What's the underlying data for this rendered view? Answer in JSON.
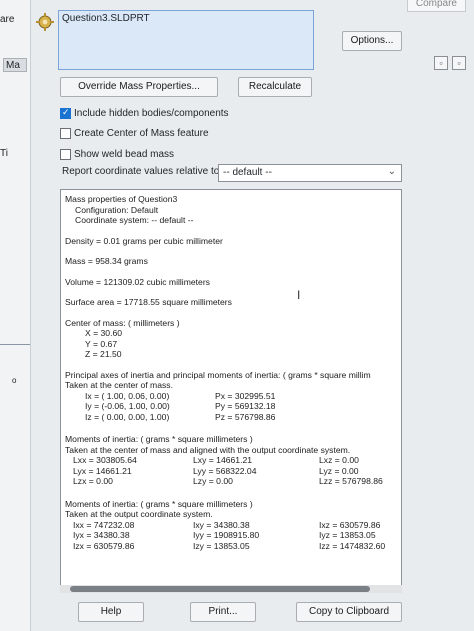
{
  "left_strip": {
    "top_text": "are",
    "box_text": "Ma",
    "mid_text": "Ti",
    "small_text": "o"
  },
  "header": {
    "compare": "Compare",
    "part_name": "Question3.SLDPRT",
    "options": "Options...",
    "override": "Override Mass Properties...",
    "recalculate": "Recalculate"
  },
  "checks": [
    {
      "label": "Include hidden bodies/components",
      "checked": true
    },
    {
      "label": "Create Center of Mass feature",
      "checked": false
    },
    {
      "label": "Show weld bead mass",
      "checked": false
    }
  ],
  "report": {
    "label": "Report coordinate values relative to:",
    "value": "-- default --"
  },
  "results": {
    "title": "Mass properties of Question3",
    "configuration": "Configuration: Default",
    "coord_system": "Coordinate system: -- default --",
    "density": "Density = 0.01 grams per cubic millimeter",
    "mass": "Mass = 958.34 grams",
    "volume": "Volume = 121309.02 cubic millimeters",
    "surface": "Surface area = 17718.55  square millimeters",
    "com_title": "Center of mass: ( millimeters )",
    "com_x": "X = 30.60",
    "com_y": "Y = 0.67",
    "com_z": "Z = 21.50",
    "pa_title": "Principal axes of inertia and principal moments of inertia: ( grams *  square millim",
    "pa_taken": "Taken at the center of mass.",
    "ix": "Ix = ( 1.00,  0.06,  0.00)",
    "iy": "Iy = (-0.06,  1.00,  0.00)",
    "iz": "Iz = ( 0.00,  0.00,  1.00)",
    "px": "Px = 302995.51",
    "py": "Py = 569132.18",
    "pz": "Pz = 576798.86",
    "moi_title": "Moments of inertia: ( grams *  square millimeters )",
    "moi_taken": "Taken at the center of mass and aligned with the output coordinate system.",
    "lxx": "Lxx = 303805.64",
    "lxy": "Lxy = 14661.21",
    "lxz": "Lxz = 0.00",
    "lyx": "Lyx = 14661.21",
    "lyy": "Lyy = 568322.04",
    "lyz": "Lyz = 0.00",
    "lzx": "Lzx = 0.00",
    "lzy": "Lzy = 0.00",
    "lzz": "Lzz = 576798.86",
    "moi2_title": "Moments of inertia: ( grams *  square millimeters )",
    "moi2_taken": "Taken at the output coordinate system.",
    "ixx": "Ixx = 747232.08",
    "ixy": "Ixy = 34380.38",
    "ixz": "Ixz = 630579.86",
    "iyx": "Iyx = 34380.38",
    "iyy": "Iyy = 1908915.80",
    "iyz": "Iyz = 13853.05",
    "izx": "Izx = 630579.86",
    "izy": "Izy = 13853.05",
    "izz": "Izz = 1474832.60"
  },
  "footer": {
    "help": "Help",
    "print": "Print...",
    "copy": "Copy to Clipboard"
  }
}
